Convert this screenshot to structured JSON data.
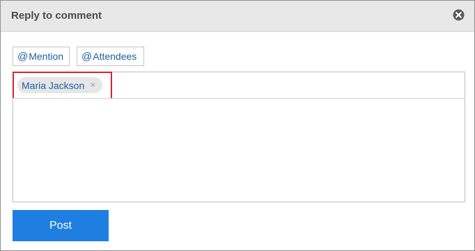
{
  "dialog": {
    "title": "Reply to comment",
    "close_icon": "close-circle-icon"
  },
  "toolbar": {
    "mention_at": "@",
    "mention_label": "Mention",
    "attendees_at": "@",
    "attendees_label": "Attendees"
  },
  "recipients": [
    {
      "name": "Maria Jackson",
      "remove_glyph": "×"
    }
  ],
  "comment": {
    "value": ""
  },
  "actions": {
    "post_label": "Post"
  },
  "colors": {
    "header_bg": "#e8e8e8",
    "link_blue": "#1a5fa5",
    "post_button": "#1f7fe0",
    "highlight_red": "#d9232d"
  }
}
